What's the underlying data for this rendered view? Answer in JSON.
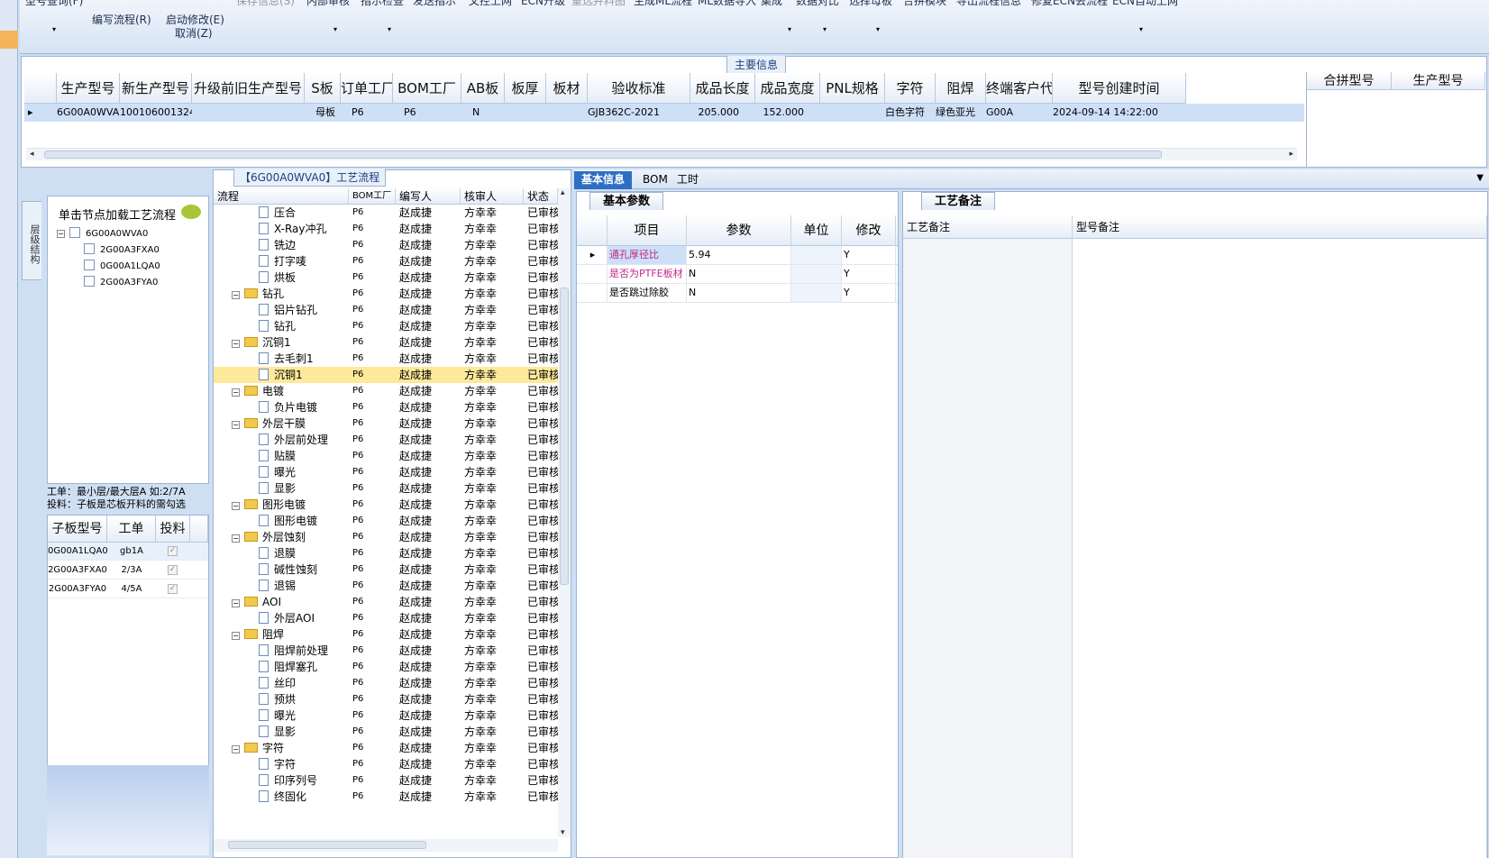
{
  "toolbar": {
    "buttons": [
      {
        "label": "型号查询(F)",
        "disabled": false
      },
      {
        "label": "编写流程(R)",
        "disabled": false
      },
      {
        "label": "启动修改(E)",
        "disabled": false
      },
      {
        "label": "取消(Z)",
        "disabled": false
      },
      {
        "label": "保存信息(S)",
        "disabled": true
      },
      {
        "label": "内部审核",
        "disabled": false
      },
      {
        "label": "指示检查",
        "disabled": false
      },
      {
        "label": "发送指示",
        "disabled": false
      },
      {
        "label": "文控上网",
        "disabled": false
      },
      {
        "label": "ECN升级",
        "disabled": false
      },
      {
        "label": "重选并料图",
        "disabled": true
      },
      {
        "label": "生成ML流程",
        "disabled": false
      },
      {
        "label": "ML数据导入",
        "disabled": false
      },
      {
        "label": "集成",
        "disabled": false
      },
      {
        "label": "数据对比",
        "disabled": false
      },
      {
        "label": "选择母板",
        "disabled": false
      },
      {
        "label": "合拼模块",
        "disabled": false
      },
      {
        "label": "导出流程信息",
        "disabled": false
      },
      {
        "label": "修复ECN丢流程",
        "disabled": false
      },
      {
        "label": "ECN自动上网",
        "disabled": false
      }
    ]
  },
  "main_info": {
    "caption": "主要信息",
    "columns": [
      "生产型号",
      "新生产型号",
      "升级前旧生产型号",
      "S板",
      "订单工厂",
      "BOM工厂",
      "AB板",
      "板厚",
      "板材",
      "验收标准",
      "成品长度",
      "成品宽度",
      "PNL规格",
      "字符",
      "阻焊",
      "终端客户代码",
      "型号创建时间"
    ],
    "row": [
      "6G00A0WVA0",
      "10010600132478",
      "",
      "母板",
      "P6",
      "P6",
      "N",
      "",
      "",
      "GJB362C-2021",
      "205.000",
      "152.000",
      "",
      "白色字符",
      "绿色亚光",
      "G00A",
      "2024-09-14 14:22:00"
    ],
    "merge_columns": [
      "合拼型号",
      "生产型号"
    ]
  },
  "left_panel": {
    "vertical_tab": "层级结构",
    "hint": "单击节点加载工艺流程",
    "tree": [
      {
        "label": "6G00A0WVA0",
        "level": 0
      },
      {
        "label": "2G00A3FXA0",
        "level": 1
      },
      {
        "label": "0G00A1LQA0",
        "level": 1
      },
      {
        "label": "2G00A3FYA0",
        "level": 1
      }
    ],
    "info_line1": "工单：最小层/最大层A 如:2/7A",
    "info_line2": "投料：子板是芯板开料的需勾选",
    "sub_columns": [
      "子板型号",
      "工单",
      "投料"
    ],
    "sub_rows": [
      {
        "model": "0G00A1LQA0",
        "order": "gb1A",
        "feed": "✓"
      },
      {
        "model": "2G00A3FXA0",
        "order": "2/3A",
        "feed": "✓"
      },
      {
        "model": "2G00A3FYA0",
        "order": "4/5A",
        "feed": "✓"
      }
    ]
  },
  "flow": {
    "caption": "【6G00A0WVA0】工艺流程",
    "columns": [
      "流程",
      "BOM工厂",
      "编写人",
      "核审人",
      "状态"
    ],
    "rows": [
      {
        "name": "压合",
        "type": "doc",
        "level": 1,
        "bom": "P6",
        "writer": "赵成捷",
        "reviewer": "方幸幸",
        "status": "已审核"
      },
      {
        "name": "X-Ray冲孔",
        "type": "doc",
        "level": 1,
        "bom": "P6",
        "writer": "赵成捷",
        "reviewer": "方幸幸",
        "status": "已审核"
      },
      {
        "name": "铣边",
        "type": "doc",
        "level": 1,
        "bom": "P6",
        "writer": "赵成捷",
        "reviewer": "方幸幸",
        "status": "已审核"
      },
      {
        "name": "打字唛",
        "type": "doc",
        "level": 1,
        "bom": "P6",
        "writer": "赵成捷",
        "reviewer": "方幸幸",
        "status": "已审核"
      },
      {
        "name": "烘板",
        "type": "doc",
        "level": 1,
        "bom": "P6",
        "writer": "赵成捷",
        "reviewer": "方幸幸",
        "status": "已审核"
      },
      {
        "name": "钻孔",
        "type": "folder",
        "level": 0,
        "bom": "P6",
        "writer": "赵成捷",
        "reviewer": "方幸幸",
        "status": "已审核"
      },
      {
        "name": "铝片钻孔",
        "type": "doc",
        "level": 1,
        "bom": "P6",
        "writer": "赵成捷",
        "reviewer": "方幸幸",
        "status": "已审核"
      },
      {
        "name": "钻孔",
        "type": "doc",
        "level": 1,
        "bom": "P6",
        "writer": "赵成捷",
        "reviewer": "方幸幸",
        "status": "已审核"
      },
      {
        "name": "沉铜1",
        "type": "folder",
        "level": 0,
        "bom": "P6",
        "writer": "赵成捷",
        "reviewer": "方幸幸",
        "status": "已审核"
      },
      {
        "name": "去毛刺1",
        "type": "doc",
        "level": 1,
        "bom": "P6",
        "writer": "赵成捷",
        "reviewer": "方幸幸",
        "status": "已审核"
      },
      {
        "name": "沉铜1",
        "type": "doc",
        "level": 1,
        "bom": "P6",
        "writer": "赵成捷",
        "reviewer": "方幸幸",
        "status": "已审核",
        "selected": true
      },
      {
        "name": "电镀",
        "type": "folder",
        "level": 0,
        "bom": "P6",
        "writer": "赵成捷",
        "reviewer": "方幸幸",
        "status": "已审核"
      },
      {
        "name": "负片电镀",
        "type": "doc",
        "level": 1,
        "bom": "P6",
        "writer": "赵成捷",
        "reviewer": "方幸幸",
        "status": "已审核"
      },
      {
        "name": "外层干膜",
        "type": "folder",
        "level": 0,
        "bom": "P6",
        "writer": "赵成捷",
        "reviewer": "方幸幸",
        "status": "已审核"
      },
      {
        "name": "外层前处理",
        "type": "doc",
        "level": 1,
        "bom": "P6",
        "writer": "赵成捷",
        "reviewer": "方幸幸",
        "status": "已审核"
      },
      {
        "name": "贴膜",
        "type": "doc",
        "level": 1,
        "bom": "P6",
        "writer": "赵成捷",
        "reviewer": "方幸幸",
        "status": "已审核"
      },
      {
        "name": "曝光",
        "type": "doc",
        "level": 1,
        "bom": "P6",
        "writer": "赵成捷",
        "reviewer": "方幸幸",
        "status": "已审核"
      },
      {
        "name": "显影",
        "type": "doc",
        "level": 1,
        "bom": "P6",
        "writer": "赵成捷",
        "reviewer": "方幸幸",
        "status": "已审核"
      },
      {
        "name": "图形电镀",
        "type": "folder",
        "level": 0,
        "bom": "P6",
        "writer": "赵成捷",
        "reviewer": "方幸幸",
        "status": "已审核"
      },
      {
        "name": "图形电镀",
        "type": "doc",
        "level": 1,
        "bom": "P6",
        "writer": "赵成捷",
        "reviewer": "方幸幸",
        "status": "已审核"
      },
      {
        "name": "外层蚀刻",
        "type": "folder",
        "level": 0,
        "bom": "P6",
        "writer": "赵成捷",
        "reviewer": "方幸幸",
        "status": "已审核"
      },
      {
        "name": "退膜",
        "type": "doc",
        "level": 1,
        "bom": "P6",
        "writer": "赵成捷",
        "reviewer": "方幸幸",
        "status": "已审核"
      },
      {
        "name": "碱性蚀刻",
        "type": "doc",
        "level": 1,
        "bom": "P6",
        "writer": "赵成捷",
        "reviewer": "方幸幸",
        "status": "已审核"
      },
      {
        "name": "退锡",
        "type": "doc",
        "level": 1,
        "bom": "P6",
        "writer": "赵成捷",
        "reviewer": "方幸幸",
        "status": "已审核"
      },
      {
        "name": "AOI",
        "type": "folder",
        "level": 0,
        "bom": "P6",
        "writer": "赵成捷",
        "reviewer": "方幸幸",
        "status": "已审核"
      },
      {
        "name": "外层AOI",
        "type": "doc",
        "level": 1,
        "bom": "P6",
        "writer": "赵成捷",
        "reviewer": "方幸幸",
        "status": "已审核"
      },
      {
        "name": "阻焊",
        "type": "folder",
        "level": 0,
        "bom": "P6",
        "writer": "赵成捷",
        "reviewer": "方幸幸",
        "status": "已审核"
      },
      {
        "name": "阻焊前处理",
        "type": "doc",
        "level": 1,
        "bom": "P6",
        "writer": "赵成捷",
        "reviewer": "方幸幸",
        "status": "已审核"
      },
      {
        "name": "阻焊塞孔",
        "type": "doc",
        "level": 1,
        "bom": "P6",
        "writer": "赵成捷",
        "reviewer": "方幸幸",
        "status": "已审核"
      },
      {
        "name": "丝印",
        "type": "doc",
        "level": 1,
        "bom": "P6",
        "writer": "赵成捷",
        "reviewer": "方幸幸",
        "status": "已审核"
      },
      {
        "name": "预烘",
        "type": "doc",
        "level": 1,
        "bom": "P6",
        "writer": "赵成捷",
        "reviewer": "方幸幸",
        "status": "已审核"
      },
      {
        "name": "曝光",
        "type": "doc",
        "level": 1,
        "bom": "P6",
        "writer": "赵成捷",
        "reviewer": "方幸幸",
        "status": "已审核"
      },
      {
        "name": "显影",
        "type": "doc",
        "level": 1,
        "bom": "P6",
        "writer": "赵成捷",
        "reviewer": "方幸幸",
        "status": "已审核"
      },
      {
        "name": "字符",
        "type": "folder",
        "level": 0,
        "bom": "P6",
        "writer": "赵成捷",
        "reviewer": "方幸幸",
        "status": "已审核"
      },
      {
        "name": "字符",
        "type": "doc",
        "level": 1,
        "bom": "P6",
        "writer": "赵成捷",
        "reviewer": "方幸幸",
        "status": "已审核"
      },
      {
        "name": "印序列号",
        "type": "doc",
        "level": 1,
        "bom": "P6",
        "writer": "赵成捷",
        "reviewer": "方幸幸",
        "status": "已审核"
      },
      {
        "name": "终固化",
        "type": "doc",
        "level": 1,
        "bom": "P6",
        "writer": "赵成捷",
        "reviewer": "方幸幸",
        "status": "已审核"
      }
    ]
  },
  "right_tabs": [
    "基本信息",
    "BOM",
    "工时"
  ],
  "basic": {
    "subtab": "基本参数",
    "columns": [
      "项目",
      "参数",
      "单位",
      "修改"
    ],
    "rows": [
      {
        "item": "通孔厚径比",
        "param": "5.94",
        "unit": "",
        "modify": "Y",
        "color": "#c0288a"
      },
      {
        "item": "是否为PTFE板材",
        "param": "N",
        "unit": "",
        "modify": "Y",
        "color": "#c0288a"
      },
      {
        "item": "是否跳过除胶",
        "param": "N",
        "unit": "",
        "modify": "Y",
        "color": "#000000"
      }
    ]
  },
  "notes": {
    "subtab": "工艺备注",
    "col1": "工艺备注",
    "col2": "型号备注"
  },
  "colors": {
    "accent": "#2e6fc1",
    "selected_row": "#fde99a",
    "grid_selected": "#cde0f7"
  }
}
